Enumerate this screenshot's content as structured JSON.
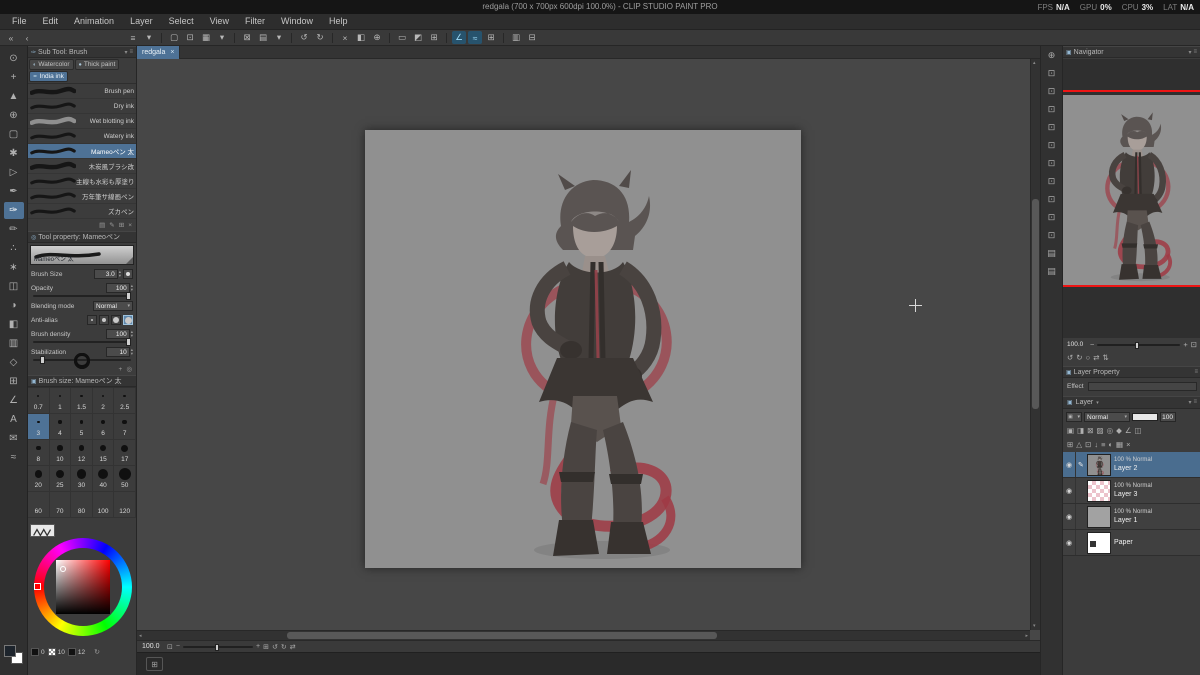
{
  "glyphs": {
    "menu": "≡",
    "caret": "▾",
    "caret_up": "▴",
    "close": "×",
    "minus": "−",
    "plus": "+",
    "fit": "⊡",
    "actual": "⊞",
    "rotate_left": "↺",
    "rotate_right": "↻",
    "flip_h": "⇄",
    "flip_v": "⇅",
    "reset": "○",
    "eye": "◉",
    "pen": "✎",
    "square": "▣",
    "history": "↻",
    "add": "+",
    "settings": "◎",
    "new_item": "▤",
    "copy": "⊞",
    "trash": "×",
    "edit": "✎",
    "brush_tab_icon": "✑",
    "left1": "«",
    "left2": "‹",
    "timeline": "⊞",
    "chip_dark": "■"
  },
  "titlebar": {
    "title": "redgala (700 x 700px 600dpi 100.0%) - CLIP STUDIO PAINT PRO",
    "stats": [
      {
        "label": "FPS",
        "value": "N/A"
      },
      {
        "label": "GPU",
        "value": "0%"
      },
      {
        "label": "CPU",
        "value": "3%"
      },
      {
        "label": "LAT",
        "value": "N/A"
      }
    ]
  },
  "menubar": {
    "items": [
      {
        "label": "File"
      },
      {
        "label": "Edit"
      },
      {
        "label": "Animation"
      },
      {
        "label": "Layer"
      },
      {
        "label": "Select"
      },
      {
        "label": "View"
      },
      {
        "label": "Filter"
      },
      {
        "label": "Window"
      },
      {
        "label": "Help"
      }
    ]
  },
  "toolbar": {
    "buttons": [
      {
        "name": "collapse-palette-left-button",
        "glyph": "«"
      },
      {
        "name": "collapse-palette-left-2-button",
        "glyph": "‹"
      },
      {
        "space": true,
        "glyph": ""
      },
      {
        "name": "main-menu-button",
        "glyph": "≡"
      },
      {
        "name": "menu-caret",
        "glyph": "▾"
      },
      {
        "sep": true,
        "glyph": ""
      },
      {
        "name": "new-file-button",
        "glyph": "▢"
      },
      {
        "name": "open-file-button",
        "glyph": "⊡"
      },
      {
        "name": "save-button",
        "glyph": "▦"
      },
      {
        "name": "save-caret",
        "glyph": "▾"
      },
      {
        "sep": true,
        "glyph": ""
      },
      {
        "name": "export-button",
        "glyph": "⊠"
      },
      {
        "name": "print-button",
        "glyph": "▤"
      },
      {
        "name": "print-caret",
        "glyph": "▾"
      },
      {
        "sep": true,
        "glyph": ""
      },
      {
        "name": "undo-button",
        "glyph": "↺"
      },
      {
        "name": "redo-button",
        "glyph": "↻"
      },
      {
        "sep": true,
        "glyph": ""
      },
      {
        "name": "clear-button",
        "glyph": "×"
      },
      {
        "name": "fill-button",
        "glyph": "◧"
      },
      {
        "name": "scale-rotate-button",
        "glyph": "⊕"
      },
      {
        "sep": true,
        "glyph": ""
      },
      {
        "name": "deselect-button",
        "glyph": "▭"
      },
      {
        "name": "invert-selection-button",
        "glyph": "◩"
      },
      {
        "name": "selection-border-button",
        "glyph": "⊞"
      },
      {
        "sep": true,
        "glyph": ""
      },
      {
        "name": "snap-to-ruler-button",
        "glyph": "∠",
        "selected": true
      },
      {
        "name": "snap-to-special-ruler-button",
        "glyph": "≈",
        "selected": true
      },
      {
        "name": "snap-to-grid-button",
        "glyph": "⊞"
      },
      {
        "sep": true,
        "glyph": ""
      },
      {
        "name": "ruler-display-button",
        "glyph": "▥"
      },
      {
        "name": "palette-dock-button",
        "glyph": "⊟"
      }
    ]
  },
  "toolstrip": {
    "tools": [
      {
        "name": "zoom-tool",
        "glyph": "⊙"
      },
      {
        "name": "move-view-tool",
        "glyph": "+"
      },
      {
        "name": "operation-tool",
        "glyph": "▲"
      },
      {
        "name": "move-layer-tool",
        "glyph": "⊕"
      },
      {
        "name": "selection-tool",
        "glyph": "▢"
      },
      {
        "name": "auto-select-tool",
        "glyph": "✱"
      },
      {
        "name": "eyedropper-tool",
        "glyph": "▷"
      },
      {
        "name": "pen-tool",
        "glyph": "✒"
      },
      {
        "name": "brush-tool",
        "glyph": "✑",
        "selected": true
      },
      {
        "name": "pencil-tool",
        "glyph": "✏"
      },
      {
        "name": "airbrush-tool",
        "glyph": "∴"
      },
      {
        "name": "decoration-tool",
        "glyph": "∗"
      },
      {
        "name": "eraser-tool",
        "glyph": "◫"
      },
      {
        "name": "blend-tool",
        "glyph": "◑"
      },
      {
        "name": "fill-tool",
        "glyph": "◧"
      },
      {
        "name": "gradient-tool",
        "glyph": "▥"
      },
      {
        "name": "figure-tool",
        "glyph": "◇"
      },
      {
        "name": "frame-border-tool",
        "glyph": "⊞"
      },
      {
        "name": "ruler-tool",
        "glyph": "∠"
      },
      {
        "name": "text-tool",
        "glyph": "A"
      },
      {
        "name": "balloon-tool",
        "glyph": "✉"
      },
      {
        "name": "correct-line-tool",
        "glyph": "≈"
      }
    ]
  },
  "subtool_panel": {
    "title": "Sub Tool: Brush",
    "tabs": [
      {
        "label": "Watercolor",
        "glyph": "◐"
      },
      {
        "label": "Thick paint",
        "glyph": "●"
      },
      {
        "label": "India ink",
        "glyph": "✒",
        "selected": true
      }
    ],
    "brushes": [
      {
        "label": "Brush pen",
        "variant": "thick"
      },
      {
        "label": "Dry ink",
        "variant": "thin"
      },
      {
        "label": "Wet blotting ink",
        "variant": "light"
      },
      {
        "label": "Watery ink",
        "variant": "thin"
      },
      {
        "label": "Mameoペン 太",
        "variant": "thin",
        "selected": true
      },
      {
        "label": "木炭風ブラシ改",
        "variant": "thick"
      },
      {
        "label": "主線も水彩も厚塗りも一本で!",
        "variant": "thin"
      },
      {
        "label": "万年筆サ線画ペン",
        "variant": "thin"
      },
      {
        "label": "ズカペン",
        "variant": "thin"
      }
    ]
  },
  "tool_property_panel": {
    "title": "Tool property: Mameoペン",
    "preset_name": "Mameoペン 太",
    "brush_size_label": "Brush Size",
    "brush_size_value": "3.0",
    "opacity_label": "Opacity",
    "opacity_value": "100",
    "blend_label": "Blending mode",
    "blend_value": "Normal",
    "aa_label": "Anti-alias",
    "density_label": "Brush density",
    "density_value": "100",
    "stabilization_label": "Stabilization",
    "stabilization_value": "10"
  },
  "brush_size_panel": {
    "title": "Brush size: Mameoペン 太",
    "sizes": [
      {
        "value": "0.7"
      },
      {
        "value": "1"
      },
      {
        "value": "1.5"
      },
      {
        "value": "2"
      },
      {
        "value": "2.5"
      },
      {
        "value": "3",
        "selected": true
      },
      {
        "value": "4"
      },
      {
        "value": "5"
      },
      {
        "value": "6"
      },
      {
        "value": "7"
      },
      {
        "value": "8"
      },
      {
        "value": "10"
      },
      {
        "value": "12"
      },
      {
        "value": "15"
      },
      {
        "value": "17"
      },
      {
        "value": "20"
      },
      {
        "value": "25"
      },
      {
        "value": "30"
      },
      {
        "value": "40"
      },
      {
        "value": "50"
      },
      {
        "value": "60"
      },
      {
        "value": "70"
      },
      {
        "value": "80"
      },
      {
        "value": "100"
      },
      {
        "value": "120"
      }
    ]
  },
  "color_panel": {
    "values": [
      {
        "value": "0",
        "chip": "dark"
      },
      {
        "value": "10",
        "chip": "checker"
      },
      {
        "value": "12",
        "chip": "dark"
      }
    ]
  },
  "canvas": {
    "tab_label": "redgala"
  },
  "statusbar": {
    "zoom_value": "100.0"
  },
  "right_strip": {
    "icons": [
      {
        "name": "quick-zoom-palette-icon",
        "glyph": "⊕"
      },
      {
        "name": "collapsed-palette-icon",
        "glyph": "⊡"
      },
      {
        "name": "collapsed-palette-icon",
        "glyph": "⊡"
      },
      {
        "name": "collapsed-palette-icon",
        "glyph": "⊡"
      },
      {
        "name": "collapsed-palette-icon",
        "glyph": "⊡"
      },
      {
        "name": "collapsed-palette-icon",
        "glyph": "⊡"
      },
      {
        "name": "collapsed-palette-icon",
        "glyph": "⊡"
      },
      {
        "name": "collapsed-palette-icon",
        "glyph": "⊡"
      },
      {
        "name": "collapsed-palette-icon",
        "glyph": "⊡"
      },
      {
        "name": "collapsed-palette-icon",
        "glyph": "⊡"
      },
      {
        "name": "collapsed-palette-icon",
        "glyph": "⊡"
      },
      {
        "name": "collapsed-palette-icon",
        "glyph": "▤"
      },
      {
        "name": "collapsed-palette-icon",
        "glyph": "▤"
      }
    ]
  },
  "navigator": {
    "title": "Navigator",
    "zoom_value": "100.0"
  },
  "layer_property": {
    "title": "Layer Property",
    "effect_label": "Effect"
  },
  "layer_panel": {
    "tab_label": "Layer",
    "blend_mode": "Normal",
    "opacity_value": "100",
    "icons_row1": [
      {
        "name": "layer-color-icon",
        "glyph": "▣"
      },
      {
        "name": "clip-below-icon",
        "glyph": "◨"
      },
      {
        "name": "lock-layer-icon",
        "glyph": "⊠"
      },
      {
        "name": "lock-transparent-pixels-icon",
        "glyph": "▨"
      },
      {
        "name": "enable-mask-icon",
        "glyph": "◎"
      },
      {
        "name": "reference-layer-icon",
        "glyph": "◆"
      },
      {
        "name": "ruler-icon",
        "glyph": "∠"
      },
      {
        "name": "two-pane-view-icon",
        "glyph": "◫"
      }
    ],
    "icons_row2": [
      {
        "name": "new-raster-layer-icon",
        "glyph": "⊞"
      },
      {
        "name": "new-vector-layer-icon",
        "glyph": "△"
      },
      {
        "name": "new-folder-icon",
        "glyph": "⊡"
      },
      {
        "name": "transfer-down-icon",
        "glyph": "↓"
      },
      {
        "name": "merge-down-icon",
        "glyph": "≡"
      },
      {
        "name": "create-mask-icon",
        "glyph": "◐"
      },
      {
        "name": "apply-mask-icon",
        "glyph": "▦"
      },
      {
        "name": "delete-layer-icon",
        "glyph": "×"
      }
    ],
    "layers": [
      {
        "info": "100 % Normal",
        "name": "Layer 2",
        "thumb": "char",
        "selected": true
      },
      {
        "info": "100 % Normal",
        "name": "Layer 3",
        "thumb": "checker"
      },
      {
        "info": "100 % Normal",
        "name": "Layer 1",
        "thumb": "gray"
      },
      {
        "info": "",
        "name": "Paper",
        "thumb": "white"
      }
    ]
  }
}
